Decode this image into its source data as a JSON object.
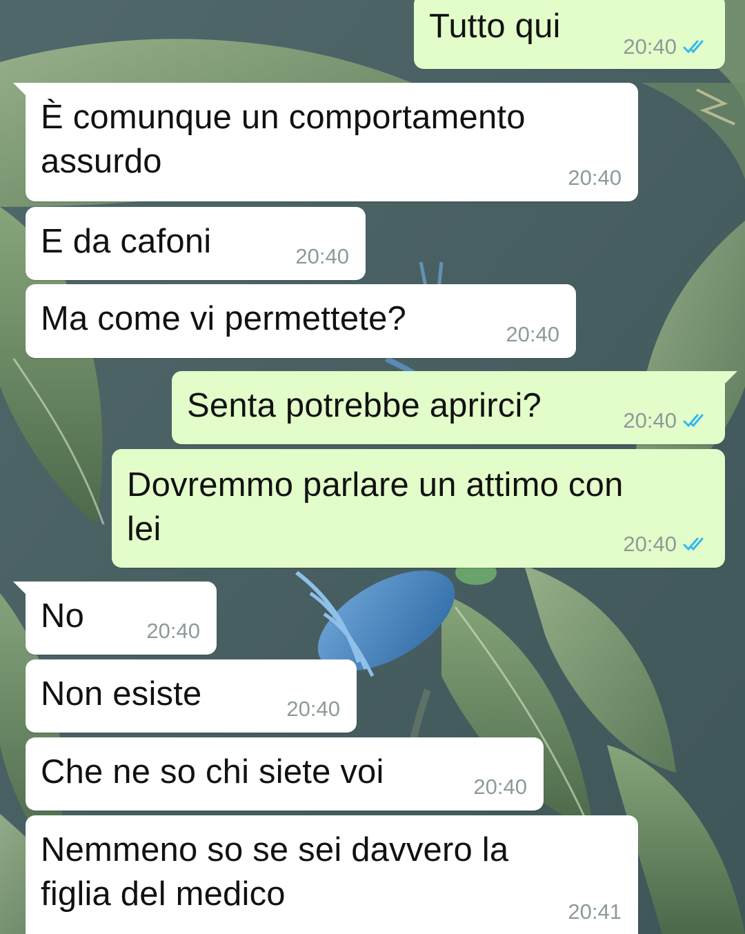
{
  "theme": {
    "incoming_bubble": "#ffffff",
    "outgoing_bubble": "#e2fdc9",
    "timestamp_color": "#8c9a9a",
    "read_tick_color": "#34b7f1",
    "wallpaper_base": "#4a6266"
  },
  "messages": [
    {
      "direction": "outgoing",
      "text": "Tutto qui",
      "time": "20:40",
      "status_icon": "double-check-read-icon"
    },
    {
      "direction": "incoming",
      "text": "È comunque un comportamento\nassurdo",
      "time": "20:40"
    },
    {
      "direction": "incoming",
      "text": "E da cafoni",
      "time": "20:40"
    },
    {
      "direction": "incoming",
      "text": "Ma come vi permettete?",
      "time": "20:40"
    },
    {
      "direction": "outgoing",
      "text": "Senta potrebbe aprirci?",
      "time": "20:40",
      "status_icon": "double-check-read-icon"
    },
    {
      "direction": "outgoing",
      "text": "Dovremmo parlare un attimo con\nlei",
      "time": "20:40",
      "status_icon": "double-check-read-icon"
    },
    {
      "direction": "incoming",
      "text": "No",
      "time": "20:40"
    },
    {
      "direction": "incoming",
      "text": "Non esiste",
      "time": "20:40"
    },
    {
      "direction": "incoming",
      "text": "Che ne so chi siete voi",
      "time": "20:40"
    },
    {
      "direction": "incoming",
      "text": "Nemmeno so se sei davvero la\nfiglia del medico",
      "time": "20:41"
    }
  ]
}
